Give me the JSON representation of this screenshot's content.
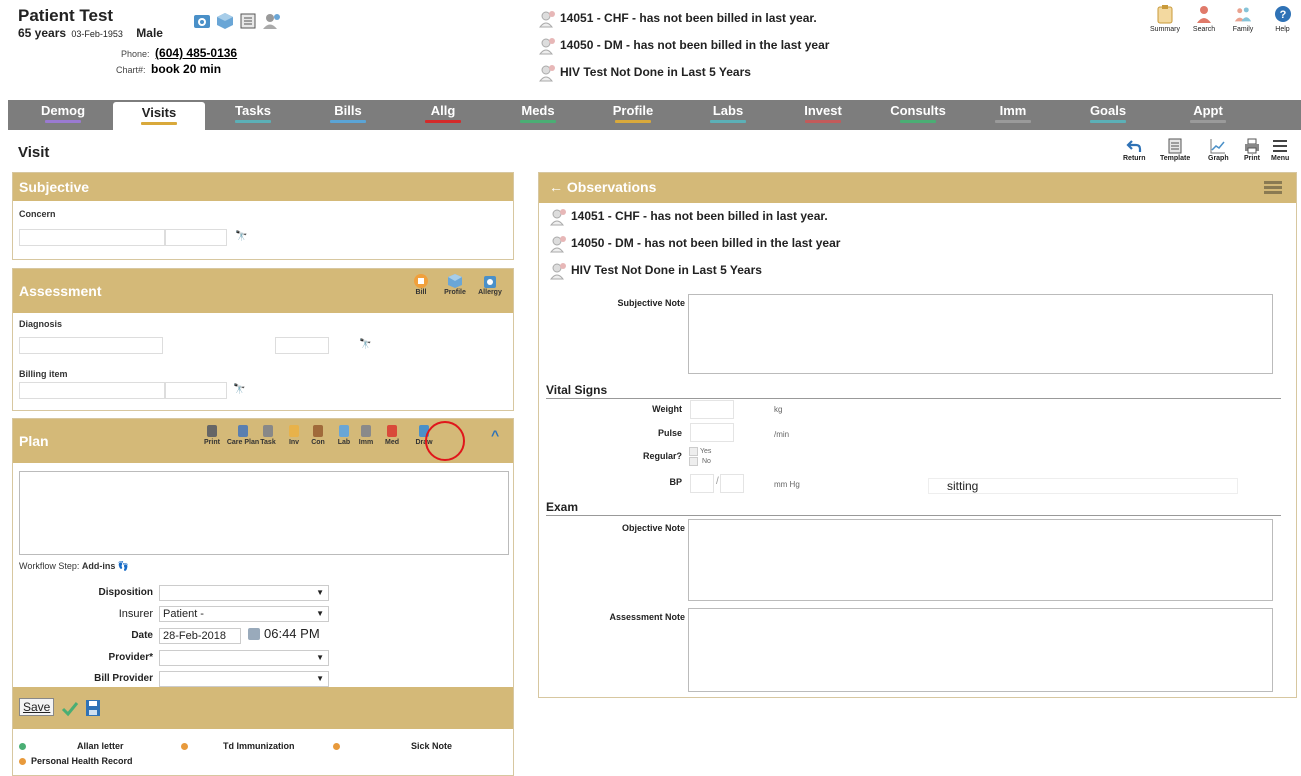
{
  "patient": {
    "name": "Patient Test",
    "age": "65 years",
    "dob": "03-Feb-1953",
    "sex": "Male",
    "phone_label": "Phone:",
    "phone": "(604) 485-0136",
    "chart_label": "Chart#:",
    "chart": "book 20 min"
  },
  "header_alerts": [
    "14051 - CHF - has not been billed in last year.",
    "14050 - DM - has not been billed in the last year",
    "HIV Test Not Done in Last 5 Years"
  ],
  "top_tools": [
    "Summary",
    "Search",
    "Family",
    "Help"
  ],
  "tabs": [
    {
      "label": "Demog",
      "color": "#9a7ad1"
    },
    {
      "label": "Visits",
      "color": "#d9a93b"
    },
    {
      "label": "Tasks",
      "color": "#5bb0b7"
    },
    {
      "label": "Bills",
      "color": "#5aa4d6"
    },
    {
      "label": "Allg",
      "color": "#d42a2a"
    },
    {
      "label": "Meds",
      "color": "#4aae74"
    },
    {
      "label": "Profile",
      "color": "#d9a93b"
    },
    {
      "label": "Labs",
      "color": "#5bb0b7"
    },
    {
      "label": "Invest",
      "color": "#c35a5a"
    },
    {
      "label": "Consults",
      "color": "#4aae74"
    },
    {
      "label": "Imm",
      "color": "#9a9a9a"
    },
    {
      "label": "Goals",
      "color": "#5bb0b7"
    },
    {
      "label": "Appt",
      "color": "#9a9a9a"
    }
  ],
  "page_title": "Visit",
  "right_tools": [
    "Return",
    "Template",
    "Graph",
    "Print",
    "Menu"
  ],
  "subjective": {
    "title": "Subjective",
    "concern_label": "Concern"
  },
  "assessment": {
    "title": "Assessment",
    "tools": [
      "Bill",
      "Profile",
      "Allergy"
    ],
    "diagnosis_label": "Diagnosis",
    "billing_label": "Billing item"
  },
  "plan": {
    "title": "Plan",
    "tools": [
      "Print",
      "Care Plan",
      "Task",
      "Inv",
      "Con",
      "Lab",
      "Imm",
      "Med",
      "Draw"
    ],
    "workflow_label": "Workflow Step:",
    "workflow_value": "Add-ins",
    "disposition_label": "Disposition",
    "disposition_value": "",
    "insurer_label": "Insurer",
    "insurer_value": "Patient -",
    "date_label": "Date",
    "date_value": "28-Feb-2018",
    "time_value": "06:44 PM",
    "provider_label": "Provider*",
    "provider_value": "",
    "bill_provider_label": "Bill Provider",
    "bill_provider_value": "",
    "save_label": "Save"
  },
  "addins": [
    {
      "label": "Allan letter",
      "color": "#4aae74"
    },
    {
      "label": "Td Immunization",
      "color": "#e89a3c"
    },
    {
      "label": "Sick Note",
      "color": "#e89a3c"
    },
    {
      "label": "Personal Health Record",
      "color": "#e89a3c"
    }
  ],
  "observations": {
    "title": "Observations",
    "alerts": [
      "14051 - CHF - has not been billed in last year.",
      "14050 - DM - has not been billed in the last year",
      "HIV Test Not Done in Last 5 Years"
    ],
    "subjective_note_label": "Subjective Note",
    "vital_signs_label": "Vital Signs",
    "weight_label": "Weight",
    "weight_unit": "kg",
    "pulse_label": "Pulse",
    "pulse_unit": "/min",
    "regular_label": "Regular?",
    "regular_yes": "Yes",
    "regular_no": "No",
    "bp_label": "BP",
    "bp_unit": "mm Hg",
    "bp_position": "sitting",
    "exam_label": "Exam",
    "objective_note_label": "Objective Note",
    "assessment_note_label": "Assessment Note"
  }
}
